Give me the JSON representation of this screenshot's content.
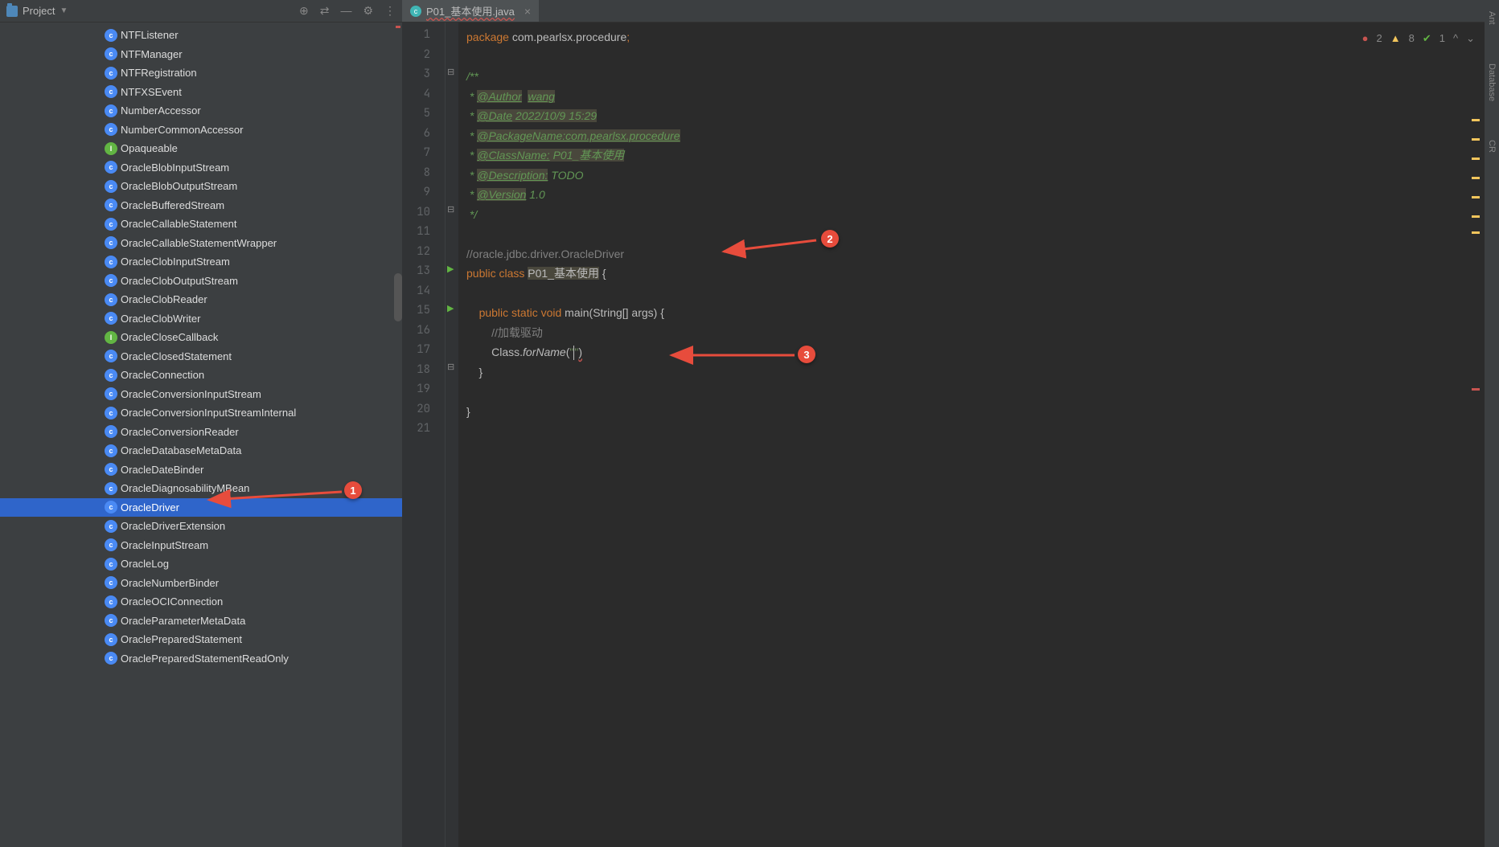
{
  "sidebar": {
    "title": "Project",
    "items": [
      {
        "name": "NTFListener",
        "t": "c"
      },
      {
        "name": "NTFManager",
        "t": "c"
      },
      {
        "name": "NTFRegistration",
        "t": "c"
      },
      {
        "name": "NTFXSEvent",
        "t": "c"
      },
      {
        "name": "NumberAccessor",
        "t": "c"
      },
      {
        "name": "NumberCommonAccessor",
        "t": "c"
      },
      {
        "name": "Opaqueable",
        "t": "i"
      },
      {
        "name": "OracleBlobInputStream",
        "t": "c"
      },
      {
        "name": "OracleBlobOutputStream",
        "t": "c"
      },
      {
        "name": "OracleBufferedStream",
        "t": "c"
      },
      {
        "name": "OracleCallableStatement",
        "t": "c"
      },
      {
        "name": "OracleCallableStatementWrapper",
        "t": "c"
      },
      {
        "name": "OracleClobInputStream",
        "t": "c"
      },
      {
        "name": "OracleClobOutputStream",
        "t": "c"
      },
      {
        "name": "OracleClobReader",
        "t": "c"
      },
      {
        "name": "OracleClobWriter",
        "t": "c"
      },
      {
        "name": "OracleCloseCallback",
        "t": "i"
      },
      {
        "name": "OracleClosedStatement",
        "t": "c"
      },
      {
        "name": "OracleConnection",
        "t": "c"
      },
      {
        "name": "OracleConversionInputStream",
        "t": "c"
      },
      {
        "name": "OracleConversionInputStreamInternal",
        "t": "c"
      },
      {
        "name": "OracleConversionReader",
        "t": "c"
      },
      {
        "name": "OracleDatabaseMetaData",
        "t": "c"
      },
      {
        "name": "OracleDateBinder",
        "t": "c"
      },
      {
        "name": "OracleDiagnosabilityMBean",
        "t": "c"
      },
      {
        "name": "OracleDriver",
        "t": "c",
        "sel": true
      },
      {
        "name": "OracleDriverExtension",
        "t": "c"
      },
      {
        "name": "OracleInputStream",
        "t": "c"
      },
      {
        "name": "OracleLog",
        "t": "c"
      },
      {
        "name": "OracleNumberBinder",
        "t": "c"
      },
      {
        "name": "OracleOCIConnection",
        "t": "c"
      },
      {
        "name": "OracleParameterMetaData",
        "t": "c"
      },
      {
        "name": "OraclePreparedStatement",
        "t": "c"
      },
      {
        "name": "OraclePreparedStatementReadOnly",
        "t": "c"
      }
    ]
  },
  "tools": {
    "target": "⊕",
    "collapse": "⇄",
    "hide": "—",
    "gear": "⚙",
    "vdots": "⋮"
  },
  "tab": {
    "name": "P01_基本使用.java",
    "close": "×"
  },
  "inspections": {
    "errors": "2",
    "warnings": "8",
    "ok": "1"
  },
  "lines": [
    "1",
    "2",
    "3",
    "4",
    "5",
    "6",
    "7",
    "8",
    "9",
    "10",
    "11",
    "12",
    "13",
    "14",
    "15",
    "16",
    "17",
    "18",
    "19",
    "20",
    "21"
  ],
  "code": {
    "l1_a": "package ",
    "l1_b": "com.pearlsx.procedure",
    "l1_c": ";",
    "l3": "/**",
    "l4_a": " * ",
    "l4_b": "@Author",
    "l4_c": "  ",
    "l4_d": "wang",
    "l5_a": " * ",
    "l5_b": "@Date",
    "l5_c": " 2022/10/9 15:29",
    "l6_a": " * ",
    "l6_b": "@PackageName:com.pearlsx.procedure",
    "l7_a": " * ",
    "l7_b": "@ClassName:",
    "l7_c": " P01_基本使用",
    "l8_a": " * ",
    "l8_b": "@Description:",
    "l8_c": " TODO",
    "l9_a": " * ",
    "l9_b": "@Version",
    "l9_c": " 1.0",
    "l10": " */",
    "l12": "//oracle.jdbc.driver.OracleDriver",
    "l13_a": "public class ",
    "l13_b": "P01_基本使用",
    "l13_c": " {",
    "l15_a": "    ",
    "l15_b": "public static void ",
    "l15_c": "main",
    "l15_d": "(String[] args) {",
    "l16_a": "        ",
    "l16_b": "//加载驱动",
    "l17_a": "        Class.",
    "l17_b": "forName",
    "l17_c": "(",
    "l17_d": "\"",
    "l17_e": "\"",
    "l17_f": ")",
    "l18": "    }",
    "l20": "}"
  },
  "rtabs": {
    "ant": "Ant",
    "db": "Database",
    "cr": "CR"
  },
  "badges": {
    "b1": "1",
    "b2": "2",
    "b3": "3"
  }
}
